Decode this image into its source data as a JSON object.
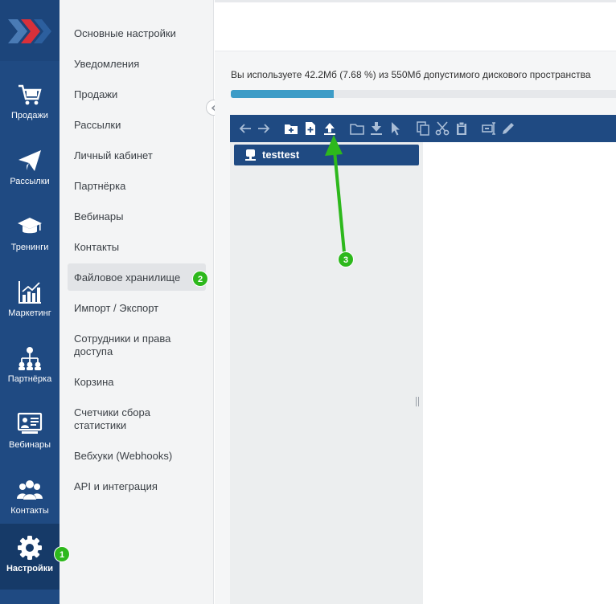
{
  "sidebar": {
    "items": [
      {
        "label": "Продажи",
        "icon": "cart-icon"
      },
      {
        "label": "Рассылки",
        "icon": "paper-plane-icon"
      },
      {
        "label": "Тренинги",
        "icon": "graduation-cap-icon"
      },
      {
        "label": "Маркетинг",
        "icon": "chart-icon"
      },
      {
        "label": "Партнёрка",
        "icon": "network-icon"
      },
      {
        "label": "Вебинары",
        "icon": "presentation-icon"
      },
      {
        "label": "Контакты",
        "icon": "users-icon"
      },
      {
        "label": "Настройки",
        "icon": "gear-icon",
        "active": true
      }
    ]
  },
  "settings_menu": {
    "items": [
      "Основные настройки",
      "Уведомления",
      "Продажи",
      "Рассылки",
      "Личный кабинет",
      "Партнёрка",
      "Вебинары",
      "Контакты",
      "Файловое хранилище",
      "Импорт / Экспорт",
      "Сотрудники и права доступа",
      "Корзина",
      "Счетчики сбора статистики",
      "Вебхуки (Webhooks)",
      "API и интеграция"
    ],
    "active_index": 8
  },
  "storage": {
    "usage_text": "Вы используете 42.2Мб (7.68 %) из 550Мб допустимого дискового пространства",
    "used_fraction": 0.2664
  },
  "file_manager": {
    "toolbar": [
      "back-icon",
      "forward-icon",
      "new-folder-icon",
      "new-file-icon",
      "upload-icon",
      "folder-open-icon",
      "download-icon",
      "select-icon",
      "copy-icon",
      "cut-icon",
      "paste-icon",
      "rename-icon",
      "edit-icon"
    ],
    "root_label": "testtest"
  },
  "annotations": {
    "step1": "1",
    "step2": "2",
    "step3": "3"
  },
  "colors": {
    "brand_blue": "#1f4a82",
    "progress_fill": "#3d9cc7",
    "badge_green": "#2db81c"
  }
}
